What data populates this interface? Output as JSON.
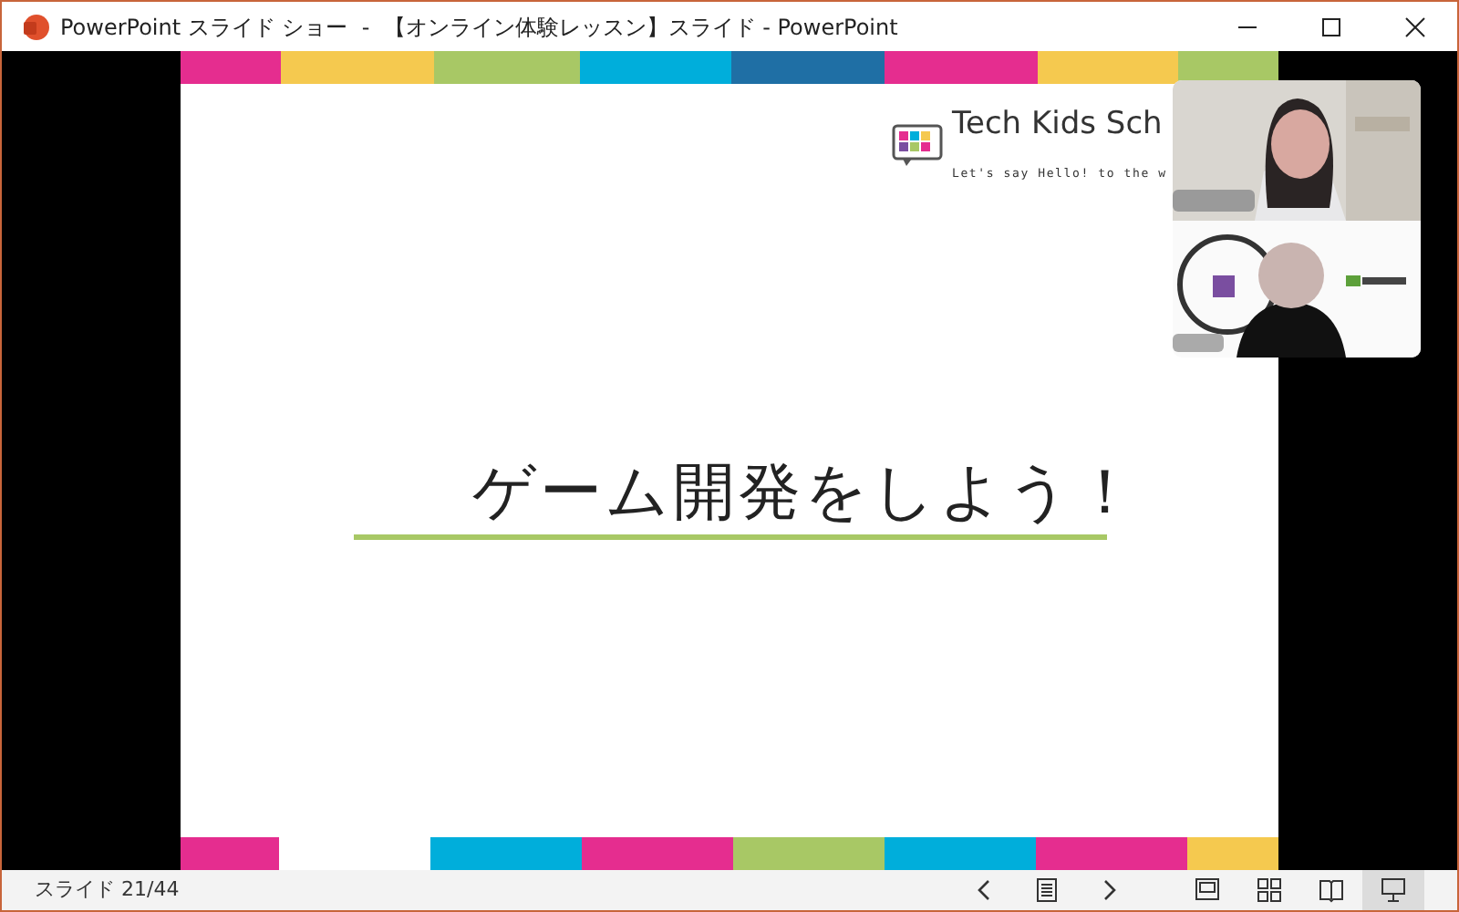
{
  "window": {
    "title": "PowerPoint スライド ショー  -  【オンライン体験レッスン】スライド - PowerPoint"
  },
  "slide": {
    "logo_title": "Tech Kids Sch",
    "logo_tagline": "Let's say Hello! to the w",
    "heading": "ゲーム開発をしよう！",
    "top_stripes": [
      {
        "color": "#e52d8f"
      },
      {
        "color": "#f5c94f"
      },
      {
        "color": "#a8c865"
      },
      {
        "color": "#00aedb"
      },
      {
        "color": "#1f6fa5"
      },
      {
        "color": "#e52d8f"
      },
      {
        "color": "#f5c94f"
      },
      {
        "color": "#a8c865"
      }
    ],
    "bottom_stripes": [
      {
        "color": "#e52d8f"
      },
      {
        "color": "#00aedb"
      },
      {
        "color": "#e52d8f"
      },
      {
        "color": "#a8c865"
      },
      {
        "color": "#00aedb"
      },
      {
        "color": "#e52d8f"
      },
      {
        "color": "#f5c94f"
      }
    ]
  },
  "status_bar": {
    "slide_counter": "スライド 21/44",
    "views": [
      {
        "kind": "normal",
        "selected": false
      },
      {
        "kind": "sorter",
        "selected": false
      },
      {
        "kind": "reading",
        "selected": false
      },
      {
        "kind": "slideshow",
        "selected": true
      }
    ]
  }
}
